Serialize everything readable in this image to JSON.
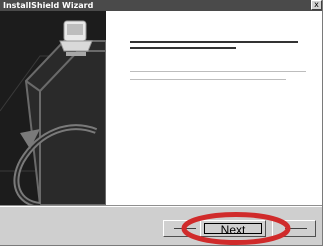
{
  "window": {
    "title": "InstallShield Wizard",
    "close_glyph": "x"
  },
  "buttons": {
    "next_label": "Next"
  },
  "icons": [
    "close-icon",
    "computer-icon",
    "cable-arrow-icon"
  ],
  "colors": {
    "title_bar": "#4a4a4a",
    "panel": "#1c1c1c",
    "highlight_ellipse": "#d02b2b"
  }
}
